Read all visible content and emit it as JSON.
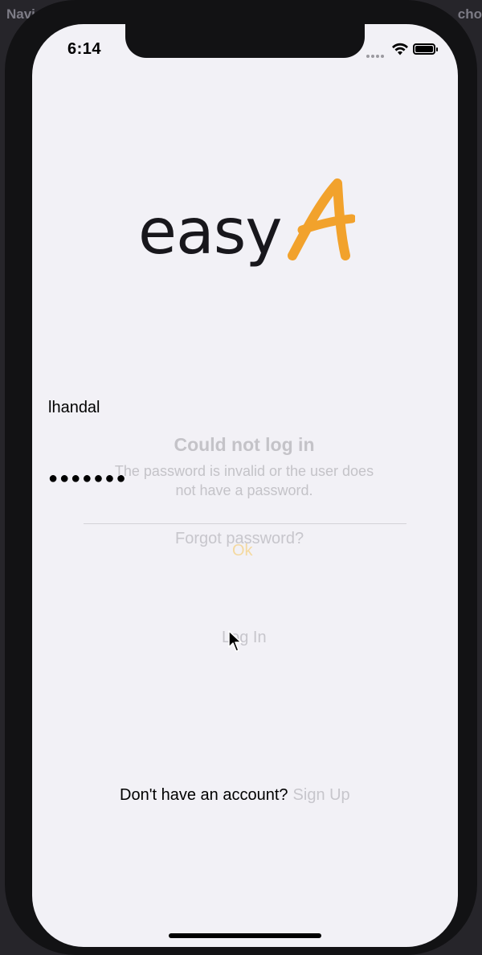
{
  "background_app": {
    "left_text": "Navi",
    "right_text": "cho"
  },
  "status_bar": {
    "time": "6:14"
  },
  "logo": {
    "text": "easy",
    "accent_color": "#f2a22c"
  },
  "form": {
    "username_value": "lhandal",
    "password_value": "●●●●●●●"
  },
  "alert": {
    "title": "Could not log in",
    "message": "The password is invalid or the user does not have a password.",
    "ok_label": "Ok"
  },
  "links": {
    "forgot_password": "Forgot password?",
    "login": "Log In",
    "no_account": "Don't have an account?",
    "sign_up": "Sign Up"
  }
}
